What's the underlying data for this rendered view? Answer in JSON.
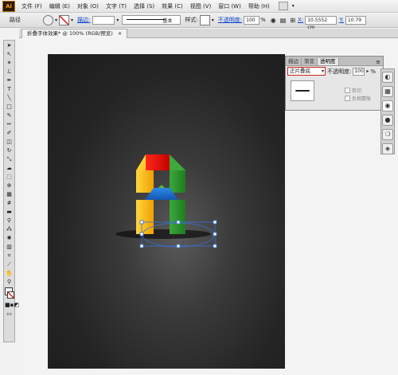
{
  "app": {
    "logo": "Ai"
  },
  "menubar": {
    "items": [
      "文件 (F)",
      "编辑 (E)",
      "对象 (O)",
      "文字 (T)",
      "选择 (S)",
      "效果 (C)",
      "视图 (V)",
      "窗口 (W)",
      "帮助 (H)"
    ],
    "extra_icon": "bridge-icon"
  },
  "control_bar": {
    "selection_label": "路径",
    "stroke_label": "描边:",
    "stroke_profile": "基本",
    "style_label": "样式:",
    "opacity_label": "不透明度:",
    "opacity_value": "100",
    "opacity_unit": "%",
    "x_value": "10.5552 cm",
    "y_value": "10.79"
  },
  "document_tab": {
    "title": "折叠字体效果* @ 100% (RGB/预览)",
    "close": "×"
  },
  "transparency_panel": {
    "tabs": [
      "描边",
      "渐变",
      "透明度"
    ],
    "active_tab": "透明度",
    "blend_mode": "正片叠底",
    "opacity_label": "不透明度:",
    "opacity_value": "100",
    "opacity_unit": "%",
    "clip_label": "剪切",
    "invert_mask_label": "反相蒙版"
  },
  "colors": {
    "red": "#e01212",
    "yellow": "#ffc21a",
    "green": "#2e9a2c",
    "blue": "#1e6fd0",
    "selection": "#3a6fd8",
    "artboard": "#242424"
  }
}
